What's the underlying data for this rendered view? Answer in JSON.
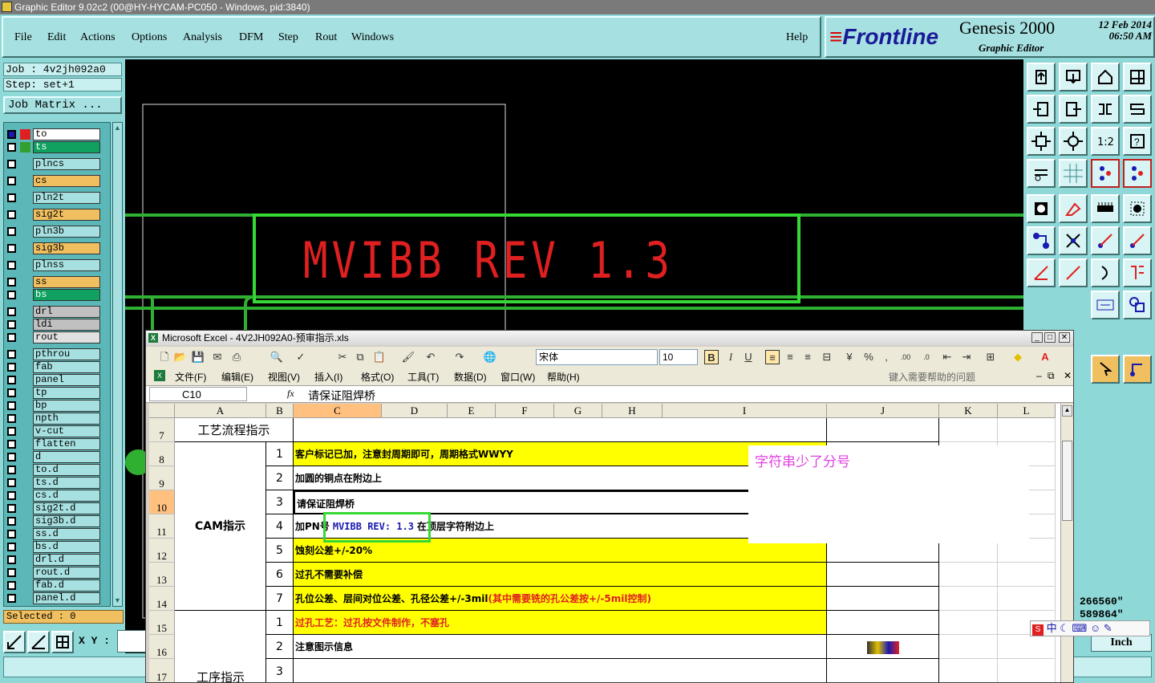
{
  "window": {
    "title": "Graphic Editor 9.02c2 (00@HY-HYCAM-PC050 - Windows, pid:3840)"
  },
  "menu": [
    "File",
    "Edit",
    "Actions",
    "Options",
    "Analysis",
    "DFM",
    "Step",
    "Rout",
    "Windows"
  ],
  "help": "Help",
  "brand": {
    "logo": "Frontline",
    "product": "Genesis 2000",
    "subtitle": "Graphic Editor",
    "date": "12 Feb 2014",
    "time": "06:50 AM"
  },
  "job": {
    "job_line": "Job : 4v2jh092a0",
    "step_line": "Step: set+1",
    "matrix_button": "Job Matrix ..."
  },
  "layers": [
    {
      "name": "to",
      "bg": "#ffffff",
      "c1": "#1a1ab0",
      "c2": "#e02020"
    },
    {
      "name": "ts",
      "bg": "#10a060",
      "c1": "#ffffff",
      "c2": "#30a030"
    },
    {
      "name": "plncs",
      "bg": "#a6e0e0"
    },
    {
      "name": "cs",
      "bg": "#f0c060"
    },
    {
      "name": "pln2t",
      "bg": "#a6e0e0"
    },
    {
      "name": "sig2t",
      "bg": "#f0c060"
    },
    {
      "name": "pln3b",
      "bg": "#a6e0e0"
    },
    {
      "name": "sig3b",
      "bg": "#f0c060"
    },
    {
      "name": "plnss",
      "bg": "#a6e0e0"
    },
    {
      "name": "ss",
      "bg": "#f0c060"
    },
    {
      "name": "bs",
      "bg": "#10a060"
    },
    {
      "name": "drl",
      "bg": "#c0c0c0"
    },
    {
      "name": "ldi",
      "bg": "#c0c0c0"
    },
    {
      "name": "rout",
      "bg": "#e0e0e0"
    },
    {
      "name": "pthrou",
      "bg": "#a6e0e0"
    },
    {
      "name": "fab",
      "bg": "#a6e0e0"
    },
    {
      "name": "panel",
      "bg": "#a6e0e0"
    },
    {
      "name": "tp",
      "bg": "#a6e0e0"
    },
    {
      "name": "bp",
      "bg": "#a6e0e0"
    },
    {
      "name": "npth",
      "bg": "#a6e0e0"
    },
    {
      "name": "v-cut",
      "bg": "#a6e0e0"
    },
    {
      "name": "flatten",
      "bg": "#a6e0e0"
    },
    {
      "name": "d",
      "bg": "#a6e0e0"
    },
    {
      "name": "to.d",
      "bg": "#a6e0e0"
    },
    {
      "name": "ts.d",
      "bg": "#a6e0e0"
    },
    {
      "name": "cs.d",
      "bg": "#a6e0e0"
    },
    {
      "name": "sig2t.d",
      "bg": "#a6e0e0"
    },
    {
      "name": "sig3b.d",
      "bg": "#a6e0e0"
    },
    {
      "name": "ss.d",
      "bg": "#a6e0e0"
    },
    {
      "name": "bs.d",
      "bg": "#a6e0e0"
    },
    {
      "name": "drl.d",
      "bg": "#a6e0e0"
    },
    {
      "name": "rout.d",
      "bg": "#a6e0e0"
    },
    {
      "name": "fab.d",
      "bg": "#a6e0e0"
    },
    {
      "name": "panel.d",
      "bg": "#a6e0e0"
    }
  ],
  "selected": "Selected : 0",
  "xy_label": "X Y :",
  "canvas_text": "MVIBB REV 1.3",
  "coords": {
    "x": "266560\"",
    "y": "589864\"",
    "unit": "Inch"
  },
  "excel": {
    "title": "Microsoft Excel - 4V2JH092A0-预审指示.xls",
    "font": "宋体",
    "size": "10",
    "menu": [
      "文件(F)",
      "编辑(E)",
      "视图(V)",
      "插入(I)",
      "格式(O)",
      "工具(T)",
      "数据(D)",
      "窗口(W)",
      "帮助(H)"
    ],
    "help_placeholder": "键入需要帮助的问题",
    "name_box": "C10",
    "fx": "fx",
    "formula": "请保证阻焊桥",
    "columns": [
      "A",
      "B",
      "C",
      "D",
      "E",
      "F",
      "G",
      "H",
      "I",
      "J",
      "K",
      "L"
    ],
    "rows": [
      "7",
      "8",
      "9",
      "10",
      "11",
      "12",
      "13",
      "14",
      "15",
      "16",
      "17"
    ],
    "a7": "工艺流程指示",
    "a_cam": "CAM指示",
    "a_proc": "工序指示",
    "items": [
      {
        "n": "1",
        "text": "客户标记已加，注意封周期即可，周期格式WWYY"
      },
      {
        "n": "2",
        "text": "加圆的铜点在附边上"
      },
      {
        "n": "3",
        "text": "请保证阻焊桥"
      },
      {
        "n": "4",
        "text": "加PN号",
        "pn": "MVIBB REV: 1.3",
        "tail": "在顶层字符附边上"
      },
      {
        "n": "5",
        "text": "蚀刻公差+/-20%"
      },
      {
        "n": "6",
        "text": "过孔不需要补偿"
      },
      {
        "n": "7",
        "text": "孔位公差、层间对位公差、孔径公差+/-3mil",
        "red": "(其中需要铣的孔公差按+/-5mil控制)"
      },
      {
        "n": "1",
        "text": "过孔工艺：过孔按文件制作，不塞孔"
      },
      {
        "n": "2",
        "text": "注意图示信息"
      },
      {
        "n": "3",
        "text": ""
      }
    ]
  },
  "note": "字符串少了分号",
  "ime": "中"
}
